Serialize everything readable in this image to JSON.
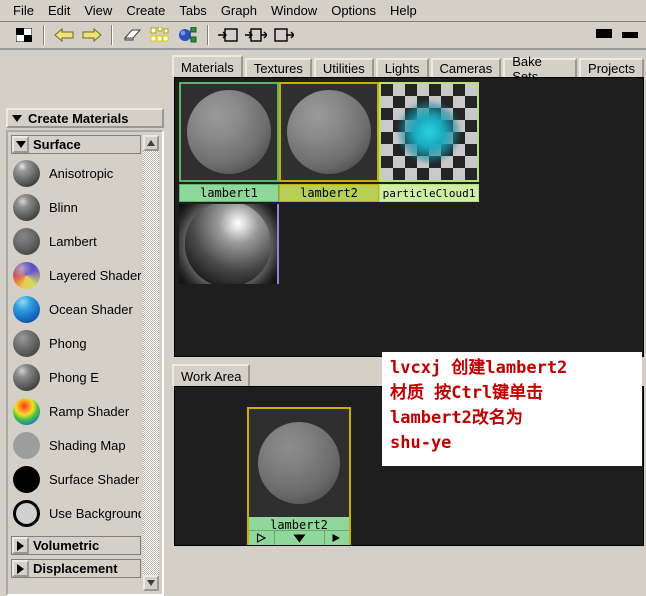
{
  "menubar": {
    "items": [
      "File",
      "Edit",
      "View",
      "Create",
      "Tabs",
      "Graph",
      "Window",
      "Options",
      "Help"
    ]
  },
  "toolbar": {
    "buttons": [
      {
        "name": "checker-swatch-icon",
        "glyph": "checker"
      },
      {
        "name": "back-arrow-icon",
        "glyph": "arrow-left"
      },
      {
        "name": "forward-arrow-icon",
        "glyph": "arrow-right"
      },
      {
        "name": "eraser-icon",
        "glyph": "eraser"
      },
      {
        "name": "graph-grid-icon",
        "glyph": "grid"
      },
      {
        "name": "graph-network-icon",
        "glyph": "network"
      },
      {
        "name": "input-connections-icon",
        "glyph": "in"
      },
      {
        "name": "input-output-connections-icon",
        "glyph": "inout"
      },
      {
        "name": "output-connections-icon",
        "glyph": "out"
      }
    ],
    "window_buttons": [
      "restore-button",
      "minimize-button"
    ]
  },
  "sidebar": {
    "title": "Create Materials",
    "groups": [
      {
        "label": "Surface",
        "expanded": true
      },
      {
        "label": "Volumetric",
        "expanded": false
      },
      {
        "label": "Displacement",
        "expanded": false
      }
    ],
    "materials": [
      {
        "label": "Anisotropic",
        "swatch": "gray-glossy"
      },
      {
        "label": "Blinn",
        "swatch": "gray-glossy"
      },
      {
        "label": "Lambert",
        "swatch": "gray-matte"
      },
      {
        "label": "Layered Shader",
        "swatch": "multicolor"
      },
      {
        "label": "Ocean Shader",
        "swatch": "ocean-blue"
      },
      {
        "label": "Phong",
        "swatch": "gray-matte"
      },
      {
        "label": "Phong E",
        "swatch": "gray-glossy"
      },
      {
        "label": "Ramp Shader",
        "swatch": "ramp-rainbow"
      },
      {
        "label": "Shading Map",
        "swatch": "flat-gray"
      },
      {
        "label": "Surface Shader",
        "swatch": "black"
      },
      {
        "label": "Use Background",
        "swatch": "outline-gray"
      }
    ],
    "scrollbar": {
      "up": "scroll-up-arrow-icon",
      "down": "scroll-down-arrow-icon"
    }
  },
  "tabs": {
    "items": [
      "Materials",
      "Textures",
      "Utilities",
      "Lights",
      "Cameras",
      "Bake Sets",
      "Projects"
    ],
    "selected": "Materials"
  },
  "materials_panel": {
    "swatches": [
      {
        "name": "lambert1",
        "kind": "sphere",
        "border": "#5db36a",
        "label_bg": "#8fd79a",
        "selected": false
      },
      {
        "name": "lambert2",
        "kind": "sphere",
        "border": "#c9b000",
        "label_bg": "#b6cf54",
        "selected": true
      },
      {
        "name": "particleCloud1",
        "kind": "cloud",
        "border": "#b6e07a",
        "label_bg": "#cfeea8",
        "selected": false
      }
    ],
    "second_row": [
      {
        "name": "",
        "kind": "glossy-sphere",
        "border": "#8a8ad0",
        "label_bg": "",
        "selected": false
      }
    ]
  },
  "work_area": {
    "tab": "Work Area",
    "node": {
      "name": "lambert2",
      "border_color": "#c9b000",
      "label_bg": "#8fd79a",
      "buttons": [
        "input-arrow-icon",
        "expand-down-icon",
        "output-arrow-icon"
      ]
    },
    "annotation": {
      "lines": [
        "lvcxj 创建lambert2",
        "材质 按Ctrl键单击",
        "lambert2改名为",
        "shu-ye"
      ],
      "color": "#c00000",
      "bg": "#ffffff"
    }
  },
  "colors": {
    "window_bg": "#d4d0c8",
    "accent_navy": "#000080",
    "canvas_bg": "#1e1e1e",
    "selected_yellow": "#c9b000",
    "node_green": "#8fd79a"
  }
}
